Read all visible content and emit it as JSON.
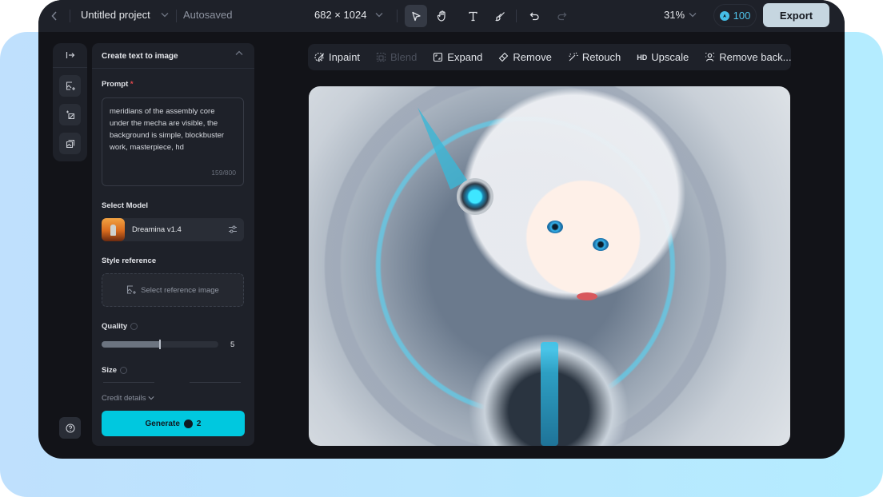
{
  "topbar": {
    "back_icon": "chevron-left-icon",
    "project_title": "Untitled project",
    "save_status": "Autosaved",
    "canvas_size": "682 × 1024",
    "tools": [
      {
        "name": "select",
        "icon": "cursor-arrow-icon",
        "active": true
      },
      {
        "name": "hand",
        "icon": "hand-icon",
        "active": false
      },
      {
        "name": "text",
        "icon": "text-icon",
        "active": false
      },
      {
        "name": "brush",
        "icon": "brush-icon",
        "active": false
      }
    ],
    "undo_icon": "undo-icon",
    "redo_icon": "redo-icon",
    "zoom_level": "31%",
    "credits": "100",
    "export_label": "Export"
  },
  "left_rail": {
    "expand_icon": "expand-panel-icon",
    "buttons": [
      "image-add-icon",
      "image-resize-icon",
      "image-layers-icon"
    ],
    "help_icon": "help-icon"
  },
  "panel": {
    "title": "Create text to image",
    "prompt_label": "Prompt",
    "prompt_required": "*",
    "prompt_value": "meridians of the assembly core under the mecha are visible, the background is simple, blockbuster work, masterpiece, hd",
    "prompt_count": "159/800",
    "model_label": "Select Model",
    "model_name": "Dreamina v1.4",
    "style_label": "Style reference",
    "style_placeholder": "Select reference image",
    "quality_label": "Quality",
    "quality_value": "5",
    "quality_fraction": 0.5,
    "size_label": "Size",
    "credit_details": "Credit details",
    "generate_label": "Generate",
    "generate_cost": "2"
  },
  "edit_toolbar": {
    "items": [
      {
        "label": "Inpaint",
        "icon": "inpaint-icon",
        "disabled": false
      },
      {
        "label": "Blend",
        "icon": "blend-icon",
        "disabled": true
      },
      {
        "label": "Expand",
        "icon": "expand-icon",
        "disabled": false
      },
      {
        "label": "Remove",
        "icon": "eraser-icon",
        "disabled": false
      },
      {
        "label": "Retouch",
        "icon": "magic-wand-icon",
        "disabled": false
      },
      {
        "label": "Upscale",
        "icon": "hd-icon",
        "disabled": false
      },
      {
        "label": "Remove back...",
        "icon": "person-cutout-icon",
        "disabled": false
      }
    ]
  },
  "canvas": {
    "image_description": "Anime girl with white hair and cyan cybernetic headpiece in a circular sci-fi mecha chamber"
  },
  "colors": {
    "accent": "#00c8df",
    "credit_blue": "#45bde6",
    "app_bg": "#121318",
    "panel_bg": "#1e2129",
    "export_bg": "#c6d6e0",
    "required": "#e5484d"
  }
}
